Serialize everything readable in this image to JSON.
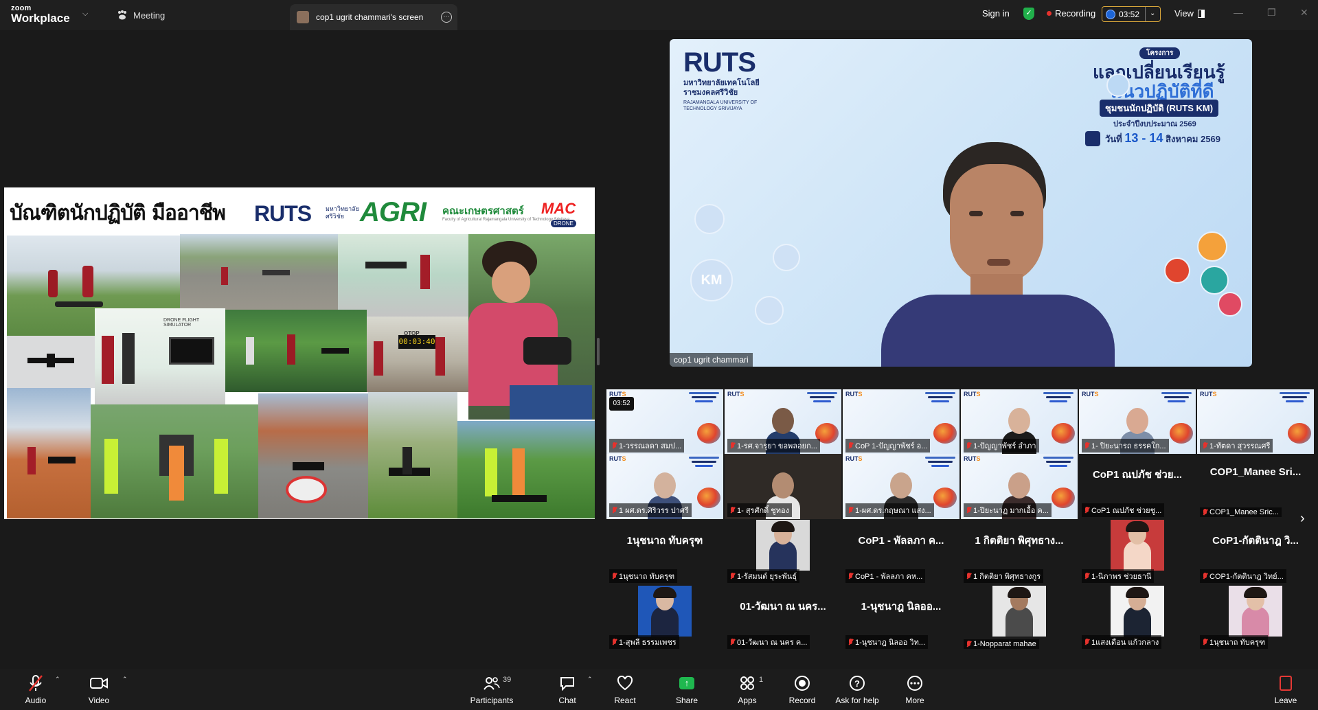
{
  "app": {
    "logo_line1": "zoom",
    "logo_line2": "Workplace",
    "meeting_tab": "Meeting",
    "share_tab": "cop1 ugrit chammari's screen",
    "sign_in": "Sign in",
    "recording": "Recording",
    "timer": "03:52",
    "view": "View"
  },
  "shared_screen": {
    "title": "บัณฑิตนักปฏิบัติ มืออาชีพ",
    "ruts": "RUTS",
    "ruts_sub": "มหาวิทยาลัย\nศรีวิชัย",
    "agri": "AGRI",
    "agri_faculty": "คณะเกษตรศาสตร์",
    "agri_faculty_en": "Faculty of Agricultural Rajamangala University of Technology Srivijaya",
    "mac": "MAC",
    "drone": "DRONE",
    "simulator_label": "DRONE FLIGHT SIMULATOR",
    "clock": "00:03:40",
    "otop": "OTOP"
  },
  "speaker": {
    "ruts": "RUTS",
    "uni_th": "มหาวิทยาลัยเทคโนโลยี\nราชมงคลศรีวิชัย",
    "uni_en": "RAJAMANGALA UNIVERSITY OF\nTECHNOLOGY SRIVIJAYA",
    "project_badge": "โครงการ",
    "title1": "แลกเปลี่ยนเรียนรู้",
    "title2": "แนวปฏิบัติที่ดี",
    "title3": "ชุมชนนักปฏิบัติ (RUTS KM)",
    "fiscal": "ประจำปีงบประมาณ 2569",
    "date_prefix": "วันที่",
    "date_main": "13 - 14",
    "date_suffix": "สิงหาคม 2569",
    "km": "KM",
    "name": "cop1 ugrit chammari"
  },
  "gallery": {
    "rows": [
      [
        {
          "label": "1-วรรณลดา  สมป...",
          "kind": "slide",
          "time": "03:52"
        },
        {
          "label": "1-รศ.จารุยา ขอพลอยก...",
          "kind": "slide-person",
          "skin": "#7a5a46",
          "shirt": "#243d6b"
        },
        {
          "label": "CoP 1-ปัญญาพัชร์ อ...",
          "kind": "slide"
        },
        {
          "label": "1-ปัญญาพัชร์ อำภา",
          "kind": "slide-person",
          "skin": "#d8b29a",
          "shirt": "#1c1c1c"
        },
        {
          "label": "1- ปิยะนารถ ธรรคใก...",
          "kind": "slide-person",
          "skin": "#d9a992",
          "shirt": "#7d8ea8"
        },
        {
          "label": "1-ทัตดา สุวรรณศรี",
          "kind": "slide"
        }
      ],
      [
        {
          "label": "1 ผศ.ดร.ศิริวรร ปาศรี",
          "kind": "slide-person",
          "skin": "#d3b29d",
          "shirt": "#3d4f7a"
        },
        {
          "label": "1- สุรศักดิ์ ชูทอง",
          "kind": "video",
          "skin": "#b38c72",
          "shirt": "#e6e6e6"
        },
        {
          "label": "1-ผศ.ดร.กฤษณา แสง...",
          "kind": "slide-person",
          "skin": "#c9a48c",
          "shirt": "#2b2b2b"
        },
        {
          "label": "1-ปิยะนาฏ มากเอื้อ ค...",
          "kind": "slide-person",
          "skin": "#caa089",
          "shirt": "#3b2b2b"
        },
        {
          "label": "CoP1 ณปภัช ช่วยชู...",
          "kind": "name",
          "title": "CoP1 ณปภัช ช่วย..."
        },
        {
          "label": "COP1_Manee Sric...",
          "kind": "name",
          "title": "COP1_Manee  Sri..."
        }
      ],
      [
        {
          "label": "1นุชนาถ ทับครุฑ",
          "kind": "name",
          "title": "1นุชนาถ ทับครุฑ"
        },
        {
          "label": "1-รัสมนต์ ยุระพันธุ์",
          "kind": "photo",
          "skin": "#d7b199",
          "shirt": "#26335c",
          "bg": "#d9d9d9"
        },
        {
          "label": "CoP1 - พัลลภา คห...",
          "kind": "name",
          "title": "CoP1 - พัลลภา ค..."
        },
        {
          "label": "1 กิตติยา พิศุทธางกูร",
          "kind": "name",
          "title": "1 กิตติยา พิศุทธาง..."
        },
        {
          "label": "1-นิภาพร ช่วยธานี",
          "kind": "photo",
          "skin": "#e2bfa6",
          "shirt": "#f4d7c7",
          "bg": "#c73b3b"
        },
        {
          "label": "COP1-กัตตินาฎ วิทย์...",
          "kind": "name",
          "title": "CoP1-กัตตินาฎ วิ..."
        }
      ],
      [
        {
          "label": "1-สุพลี ธรรมเพชร",
          "kind": "photo",
          "skin": "#d9b8a2",
          "shirt": "#1c2540",
          "bg": "#1f57b8"
        },
        {
          "label": "01-วัฒนา ณ นคร ค...",
          "kind": "name",
          "title": "01-วัฒนา ณ นคร..."
        },
        {
          "label": "1-นุชนาฎ นิลออ วิท...",
          "kind": "name",
          "title": "1-นุชนาฎ นิลออ..."
        },
        {
          "label": "1-Nopparat mahae",
          "kind": "photo",
          "skin": "#a47a5f",
          "shirt": "#4b4b4b",
          "bg": "#e6e6e6"
        },
        {
          "label": "1แสงเดือน แก้วกลาง",
          "kind": "photo",
          "skin": "#d5ae95",
          "shirt": "#1c2433",
          "bg": "#f2f2f2"
        },
        {
          "label": "1นุชนาถ ทับครุฑ",
          "kind": "photo",
          "skin": "#e3c0a8",
          "shirt": "#d88aa8",
          "bg": "#eadfe8"
        }
      ]
    ]
  },
  "toolbar": {
    "audio": "Audio",
    "video": "Video",
    "participants": "Participants",
    "participants_count": "39",
    "chat": "Chat",
    "react": "React",
    "share": "Share",
    "apps": "Apps",
    "apps_count": "1",
    "record": "Record",
    "ask_for_help": "Ask for help",
    "more": "More",
    "leave": "Leave"
  },
  "colors": {
    "background": "#1a1a1a",
    "share_green": "#1fb84f",
    "mute_red": "#e5322d",
    "recording_dot": "#e5322d",
    "ruts_navy": "#1a2e6b",
    "ruts_orange": "#f28c1c"
  }
}
